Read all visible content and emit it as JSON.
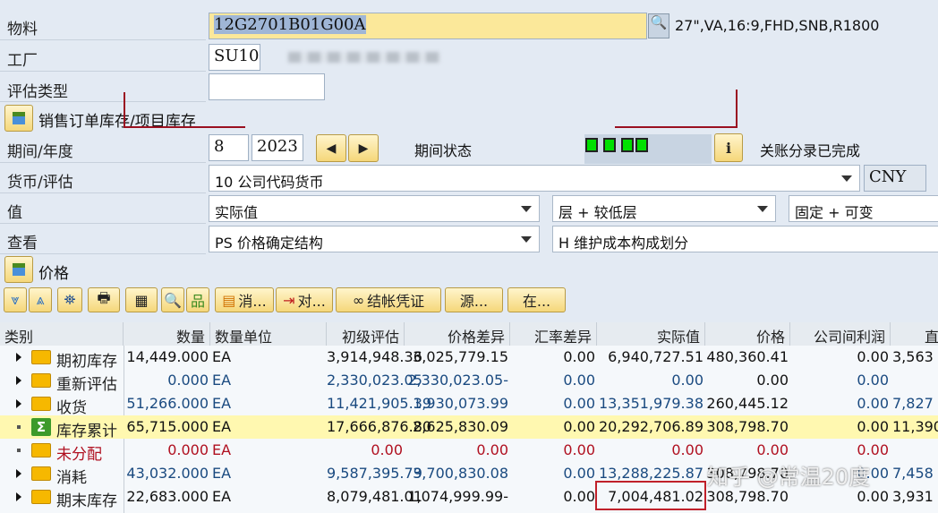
{
  "form": {
    "material_label": "物料",
    "material_value": "12G2701B01G00A",
    "material_desc": "27\",VA,16:9,FHD,SNB,R1800",
    "plant_label": "工厂",
    "plant_value": "SU10",
    "valuation_type_label": "评估类型",
    "valuation_type_value": "",
    "sales_order_stock_label": "销售订单库存/项目库存",
    "period_year_label": "期间/年度",
    "period_value": "8",
    "year_value": "2023",
    "period_status_label": "期间状态",
    "period_status_text": "关账分录已完成",
    "currency_label": "货币/评估",
    "currency_value": "10 公司代码货币",
    "currency_code": "CNY",
    "value_label": "值",
    "value_select": "实际值",
    "level_select": "层 + 较低层",
    "fixed_select": "固定 + 可变",
    "view_label": "查看",
    "view_select": "PS 价格确定结构",
    "view_select2": "H 维护成本构成划分",
    "price_section_label": "价格"
  },
  "toolbar": {
    "consume": "消...",
    "compare": "对...",
    "closing_doc": "结帐凭证",
    "source": "源...",
    "in": "在..."
  },
  "table": {
    "headers": [
      "类别",
      "数量",
      "数量单位",
      "初级评估",
      "价格差异",
      "汇率差异",
      "实际值",
      "价格",
      "公司间利润",
      "直"
    ],
    "rows": [
      {
        "category": "期初库存",
        "kind": "folder",
        "expand": "arrow",
        "color": "#111111",
        "cells": [
          "14,449.000",
          "EA",
          "3,914,948.36",
          "3,025,779.15",
          "0.00",
          "6,940,727.51",
          "480,360.41",
          "0.00",
          "3,563"
        ]
      },
      {
        "category": "重新评估",
        "kind": "folder",
        "expand": "arrow",
        "color": "#1a4a80",
        "cells": [
          "0.000",
          "EA",
          "2,330,023.05",
          "2,330,023.05-",
          "0.00",
          "0.00",
          "0.00",
          "0.00",
          ""
        ]
      },
      {
        "category": "收货",
        "kind": "folder",
        "expand": "arrow",
        "color": "#1a4a80",
        "cells": [
          "51,266.000",
          "EA",
          "11,421,905.39",
          "1,930,073.99",
          "0.00",
          "13,351,979.38",
          "260,445.12",
          "0.00",
          "7,827"
        ]
      },
      {
        "category": "库存累计",
        "kind": "sum",
        "expand": "dot",
        "color": "#111111",
        "highlight": true,
        "cells": [
          "65,715.000",
          "EA",
          "17,666,876.80",
          "2,625,830.09",
          "0.00",
          "20,292,706.89",
          "308,798.70",
          "0.00",
          "11,390"
        ]
      },
      {
        "category": "未分配",
        "kind": "folder",
        "expand": "dot",
        "color": "#b01020",
        "cells": [
          "0.000",
          "EA",
          "0.00",
          "0.00",
          "0.00",
          "0.00",
          "0.00",
          "0.00",
          ""
        ]
      },
      {
        "category": "消耗",
        "kind": "folder",
        "expand": "arrow",
        "color": "#1a4a80",
        "cells": [
          "43,032.000",
          "EA",
          "9,587,395.79",
          "3,700,830.08",
          "0.00",
          "13,288,225.87",
          "308,798.70",
          "0.00",
          "7,458"
        ]
      },
      {
        "category": "期末库存",
        "kind": "folder",
        "expand": "arrow",
        "color": "#111111",
        "cells": [
          "22,683.000",
          "EA",
          "8,079,481.01",
          "1,074,999.99-",
          "0.00",
          "7,004,481.02",
          "308,798.70",
          "0.00",
          "3,931"
        ]
      }
    ]
  },
  "watermark": "知乎 @常温20度",
  "colors": {
    "highlight": "#fff8b0",
    "annotation": "#c0202a"
  }
}
